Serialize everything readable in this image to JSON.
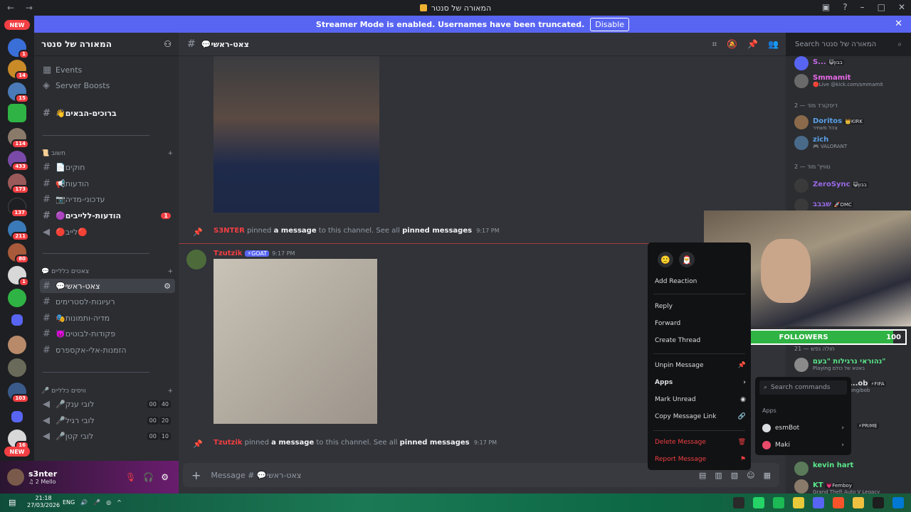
{
  "window": {
    "title": "המאורה של סנטר"
  },
  "banner": {
    "text": "Streamer Mode is enabled. Usernames have been truncated.",
    "disable_label": "Disable"
  },
  "guilds": {
    "new_top": "NEW",
    "new_bottom": "NEW",
    "badges": [
      "1",
      "14",
      "15",
      "114",
      "433",
      "173",
      "137",
      "211",
      "80",
      "1",
      "103",
      "16"
    ]
  },
  "server": {
    "name": "המאורה של סנטר"
  },
  "sidebar": {
    "events": "Events",
    "boosts": "Server Boosts",
    "welcome": "👋ברוכים-הבאים",
    "cat_important": "📜 חשוב",
    "rules": "📄חוקים",
    "announcements": "📢הודעות",
    "media_updates": "📷עדכוני-מדיה",
    "live_announcements": "🟣הודעות-ללייבים",
    "live_announcements_badge": "1",
    "live_voice": "🔴לייב🔴",
    "cat_chats": "💬 צאטים כלליים",
    "main_chat": "💬צאט-ראשי",
    "stream_ideas": "רעיונות-לסטרימים",
    "media_images": "🎭מדיה-ותמונות",
    "bot_commands": "👿פקודות-לבוטים",
    "aliexpress": "הזמנות-אלי-אקספרס",
    "cat_voice": "🎤 וויסים כלליים",
    "voice1": "🎤לובי ענק",
    "voice1_a": "00",
    "voice1_b": "40",
    "voice2": "🎤לובי רגיל",
    "voice2_a": "00",
    "voice2_b": "20",
    "voice3": "🎤לובי קטן",
    "voice3_a": "00",
    "voice3_b": "10"
  },
  "user": {
    "name": "s3nter",
    "status": "♫ 2 Mello"
  },
  "channel": {
    "name": "💬צאט-ראשי",
    "search_placeholder": "Search המאורה של סנטר"
  },
  "messages": {
    "pin1": {
      "author": "S3NTER",
      "t1": "pinned",
      "t2": "a message",
      "t3": "to this channel. See all",
      "t4": "pinned messages",
      "time": "9:17 PM"
    },
    "msg": {
      "author": "Tzutzik",
      "tag": "⚡GOAT",
      "time": "9:17 PM"
    },
    "pin2": {
      "author": "Tzutzik",
      "t1": "pinned",
      "t2": "a message",
      "t3": "to this channel. See all",
      "t4": "pinned messages",
      "time": "9:17 PM"
    }
  },
  "composer": {
    "placeholder": "Message # 💬צאט-ראשי"
  },
  "context_menu": {
    "add_reaction": "Add Reaction",
    "reply": "Reply",
    "forward": "Forward",
    "create_thread": "Create Thread",
    "unpin": "Unpin Message",
    "apps": "Apps",
    "mark_unread": "Mark Unread",
    "copy_link": "Copy Message Link",
    "delete": "Delete Message",
    "report": "Report Message"
  },
  "apps_submenu": {
    "search_placeholder": "Search commands",
    "header": "Apps",
    "items": [
      "esmBot",
      "Maki"
    ]
  },
  "members": {
    "m1": {
      "name": "S...",
      "tag": "😺בבון"
    },
    "m2": {
      "name": "Smmamit",
      "sub": "🔴Live @kick.com/smmamit"
    },
    "cat1": "דיסקורד מוד — 2",
    "m3": {
      "name": "Doritos",
      "tag": "👑KIRK",
      "sub": "צהל משחיר"
    },
    "m4": {
      "name": "zich",
      "sub": "🎮 VALORANT"
    },
    "cat2": "טוויץ' מוד — 2",
    "m5": {
      "name": "ZeroSync",
      "tag": "😺בבון"
    },
    "m6": {
      "name": "שבבב",
      "tag": "🚀DMC"
    },
    "cat3": "חולה נפש — 21",
    "m7": {
      "name": "נהוראי נרגילות \"בעם\"",
      "sub": "Playing באטא של כולם"
    },
    "m8": {
      "name": "...ob",
      "tag": "⚡FIFA",
      "sub": "ongibob"
    },
    "m9": {
      "tag": "⚡PRIME"
    },
    "m10": {
      "name": "kevin hart"
    },
    "m11": {
      "name": "KT",
      "tag": "💗Femboy",
      "sub": "Grand Theft Auto V Legacy"
    }
  },
  "webcam": {
    "followers_label": "FOLLOWERS",
    "followers_current": "94",
    "followers_goal": "100",
    "followers_fraction": 0.94
  },
  "taskbar": {
    "time": "21:18",
    "date": "27/03/2026",
    "lang": "ENG"
  },
  "colors": {
    "accent": "#5865f2",
    "danger": "#f23f43",
    "follow_green": "#2fb344"
  }
}
